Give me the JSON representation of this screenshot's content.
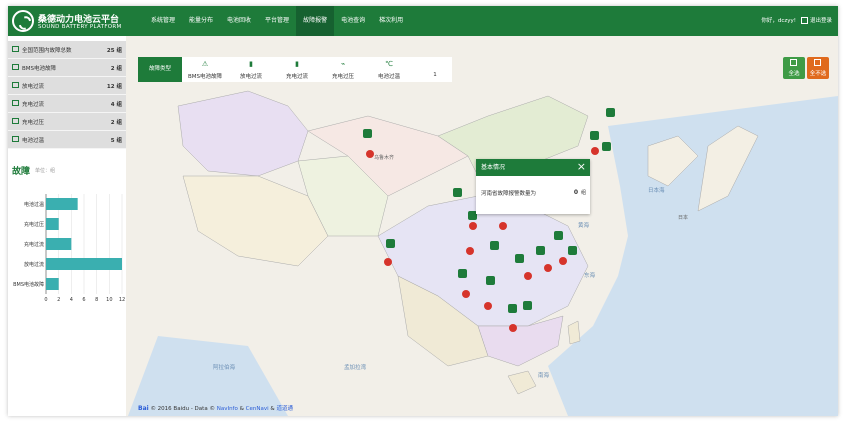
{
  "header": {
    "brand_name": "桑德动力电池云平台",
    "brand_sub": "SOUND BATTERY PLATFORM",
    "nav": [
      "系统管理",
      "能量分布",
      "电池回收",
      "平台管理",
      "故障报警",
      "电池查询",
      "梯次利用"
    ],
    "user": "你好，dczyy!",
    "logout": "退出登录"
  },
  "sidebar": {
    "stats": [
      {
        "label": "全国范围内故障总数",
        "value": "25 组"
      },
      {
        "label": "BMS电池故障",
        "value": "2 组"
      },
      {
        "label": "放电过流",
        "value": "12 组"
      },
      {
        "label": "充电过流",
        "value": "4 组"
      },
      {
        "label": "充电过压",
        "value": "2 组"
      },
      {
        "label": "电池过温",
        "value": "5 组"
      }
    ],
    "fault_title": "故障",
    "fault_unit": "单位：组"
  },
  "chart_data": {
    "type": "bar",
    "orientation": "horizontal",
    "categories": [
      "电池过温",
      "充电过压",
      "充电过流",
      "放电过流",
      "BMS电池故障"
    ],
    "values": [
      5,
      2,
      4,
      12,
      2
    ],
    "xlim": [
      0,
      12
    ],
    "xticks": [
      "0",
      "2",
      "4",
      "6",
      "8",
      "10",
      "12"
    ],
    "bar_color": "#3aafb0",
    "grid": true
  },
  "fault_types": {
    "button": "故障类型",
    "items": [
      {
        "icon": "⚠",
        "label": "BMS电池故障"
      },
      {
        "icon": "▮",
        "label": "放电过流"
      },
      {
        "icon": "▮",
        "label": "充电过流"
      },
      {
        "icon": "⌁",
        "label": "充电过压"
      },
      {
        "icon": "℃",
        "label": "电池过温"
      },
      {
        "icon": "",
        "label": "1"
      }
    ]
  },
  "actions": {
    "select_all": "全选",
    "select_none": "全不选"
  },
  "popup": {
    "title": "基本情况",
    "text": "河南省故障报警数量为",
    "count": "0",
    "unit": "组"
  },
  "map": {
    "copyright_prefix": "© 2016 Baidu - Data ©",
    "links": [
      "NavInfo",
      "CenNavi",
      "道道通"
    ],
    "baidu": "Bai",
    "seas": [
      "日本海",
      "黄海",
      "东海",
      "南海",
      "孟加拉湾",
      "阿拉伯海"
    ],
    "cities": [
      "乌鲁木齐",
      "日本",
      "冲绳"
    ]
  },
  "colors": {
    "primary": "#1e7b3a",
    "accent": "#e06a1d",
    "bar": "#3aafb0"
  }
}
